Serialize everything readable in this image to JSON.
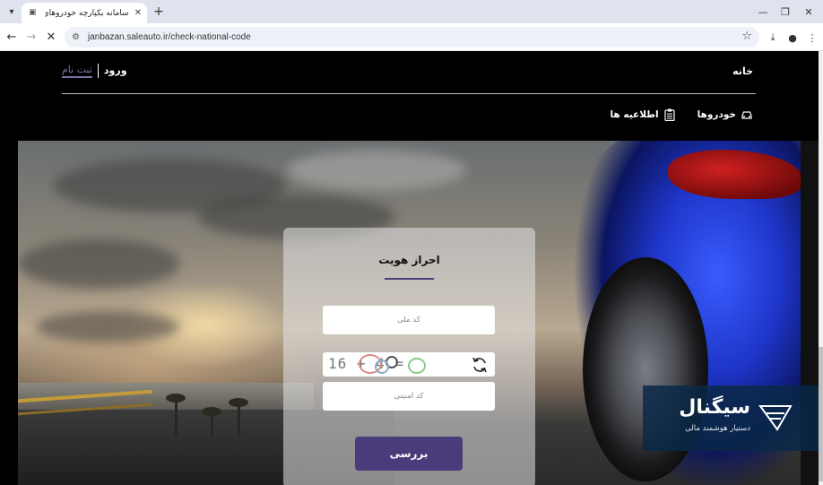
{
  "browser": {
    "tab_title": "سامانه یکپارچه خودروهای جانبازان",
    "url": "janbazan.saleauto.ir/check-national-code"
  },
  "header": {
    "home": "خانه",
    "login": "ورود",
    "register": "ثبت نام",
    "menu": [
      {
        "label": "خودروها",
        "icon": "car-icon"
      },
      {
        "label": "اطلاعیه ها",
        "icon": "clipboard-icon"
      }
    ]
  },
  "form": {
    "title": "احراز هویت",
    "national_code_placeholder": "کد ملی",
    "captcha_text": "16 + 4 =",
    "security_code_placeholder": "کد امنیتی",
    "submit_label": "بررسی"
  },
  "ad": {
    "name": "سیگنال",
    "tagline": "دستیار هوشمند مالی"
  },
  "colors": {
    "accent": "#4a3b7a",
    "register_link": "#7b73a6"
  }
}
